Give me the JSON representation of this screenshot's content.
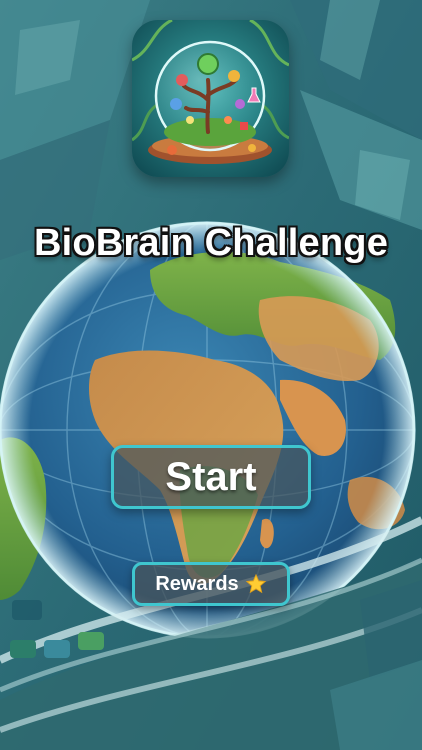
{
  "app": {
    "title": "BioBrain Challenge"
  },
  "menu": {
    "start_label": "Start",
    "rewards_label": "Rewards",
    "rewards_icon": "star-icon"
  },
  "colors": {
    "button_border": "#3fc6cf",
    "button_fill": "#46545c",
    "title_text": "#ffffff"
  },
  "icons": {
    "app_icon": "tree-terrarium-icon",
    "background": "globe-illustration"
  }
}
